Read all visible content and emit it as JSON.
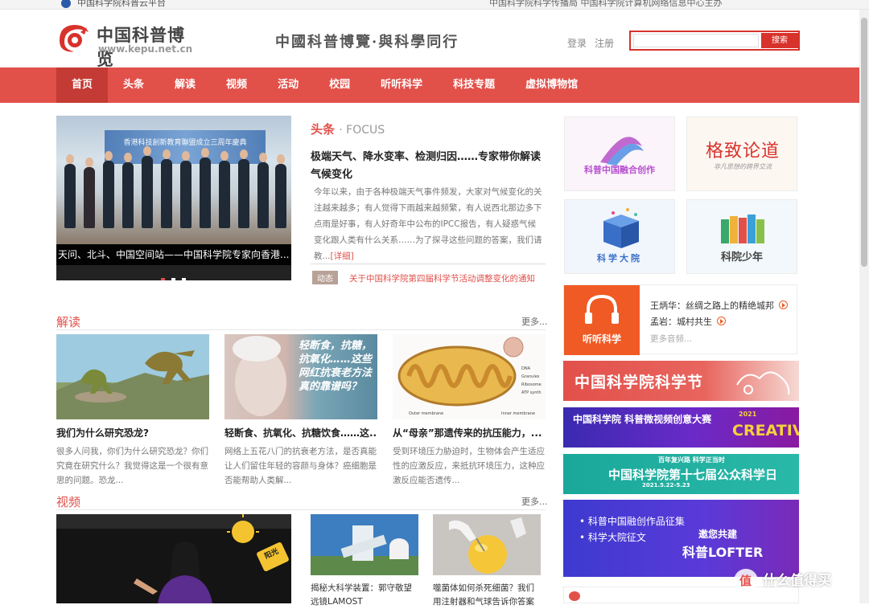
{
  "topbar": {
    "left": "中国科学院科普云平台",
    "right": "中国科学院科学传播局 中国科学院计算机网络信息中心主办"
  },
  "header": {
    "logo_name": "中国科普博览",
    "logo_url": "www.kepu.net.cn",
    "slogan": "中國科普博覽·與科學同行",
    "login": "登录",
    "register": "注册",
    "search_placeholder": "",
    "search_button": "搜索"
  },
  "nav": {
    "items": [
      "首页",
      "头条",
      "解读",
      "视频",
      "活动",
      "校园",
      "听听科学",
      "科技专题",
      "虚拟博物馆"
    ]
  },
  "hero": {
    "banner_text": "香港科技創新教育聯盟成立三周年慶典",
    "caption": "天问、北斗、中国空间站——中国科学院专家向香港..."
  },
  "focus": {
    "tag": "头条",
    "tag_en": "· FOCUS",
    "title": "极端天气、降水变率、检测归因……专家带你解读气候变化",
    "summary": "今年以来，由于各种极端天气事件频发，大家对气候变化的关注越来越多；有人觉得下雨越来越频繁，有人说西北那边多下点雨是好事，有人好奇年中公布的IPCC报告，有人疑惑气候变化跟人类有什么关系……为了探寻这些问题的答案，我们请教...",
    "more": "[详细]",
    "news_badge": "动态",
    "news_text": "关于中国科学院第四届科学节活动调整变化的通知"
  },
  "jiedu": {
    "title": "解读",
    "more": "更多...",
    "cards": [
      {
        "title": "我们为什么研究恐龙?",
        "text": "很多人问我，你们为什么研究恐龙？你们究竟在研究什么？我觉得这是一个很有意思的问题。恐龙..."
      },
      {
        "title": "轻断食、抗氧化、抗糖饮食……这...",
        "text": "网络上五花八门的抗衰老方法，是否真能让人们留住年轻的容颜与身体？癌细胞是否能帮助人类解..."
      },
      {
        "title": "从“母亲”那遗传来的抗压能力，...",
        "text": "受到环境压力胁迫时，生物体会产生适应性的应激反应，来抵抗环境压力，这种应激反应能否遗传..."
      }
    ],
    "thumb2_text": "轻断食，抗糖，抗氧化……这些网红抗衰老方法真的靠谱吗？"
  },
  "shipin": {
    "title": "视频",
    "more": "更多...",
    "cards": [
      {
        "text": "揭秘大科学装置：郭守敬望远镜LAMOST"
      },
      {
        "text": "噬菌体如何杀死细菌？我们用注射器和气球告诉你答案"
      }
    ],
    "big_tag": "阳光"
  },
  "right": {
    "tiles": [
      "科普中国融合创作",
      "格致论道",
      "科学大院",
      "科院少年"
    ],
    "gezhi_sub": "非凡思想的跨界交流",
    "listen": {
      "label": "听听科学",
      "items": [
        "王炳华：丝绸之路上的精绝城邦",
        "孟岩：城村共生"
      ],
      "more": "更多音频..."
    },
    "banners": [
      {
        "text": "中国科学院科学节"
      },
      {
        "text": "中国科学院 科普微视频创意大赛",
        "sub": "CREATIVE",
        "year": "2021"
      },
      {
        "text": "中国科学院第十七届公众科学日",
        "top": "百年复兴路 科学正当时",
        "date": "2021.5.22-5.23"
      },
      {
        "items": [
          "科普中国融创作品征集",
          "科学大院征文"
        ],
        "main1": "邀您共建",
        "main2": "科普LOFTER"
      }
    ]
  },
  "watermark": "什么值得买",
  "colors": {
    "brand": "#e2504a",
    "nav_active": "#c43a34",
    "listen": "#f05a24"
  }
}
